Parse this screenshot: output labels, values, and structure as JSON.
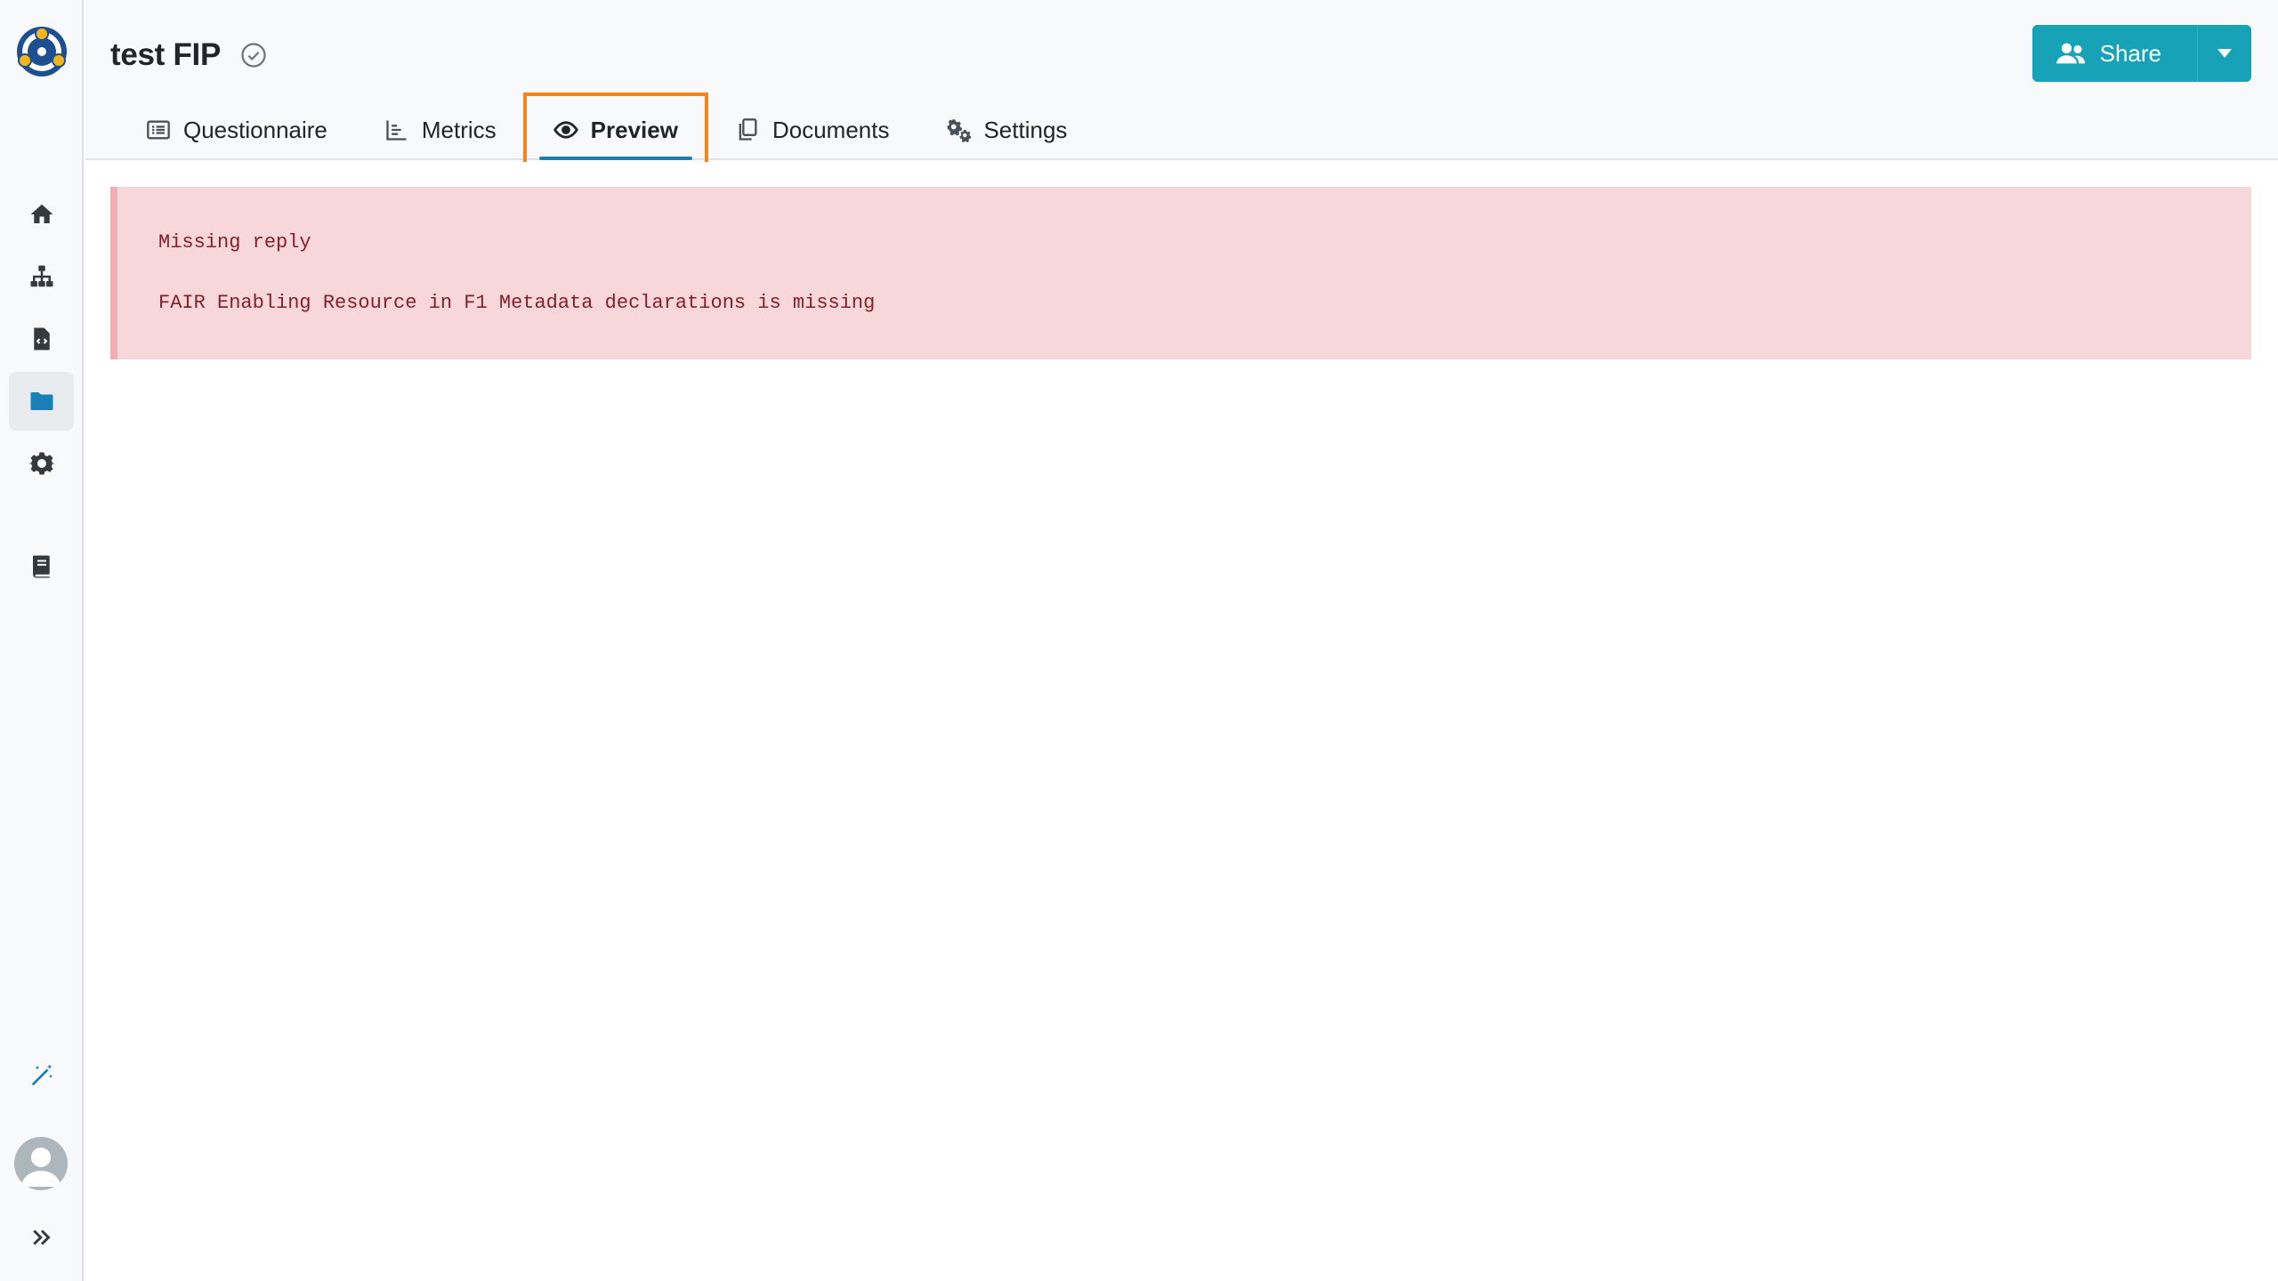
{
  "sidebar": {
    "logo_icon": "fair-connect-logo",
    "items": [
      {
        "icon": "home-icon",
        "active": false
      },
      {
        "icon": "sitemap-icon",
        "active": false
      },
      {
        "icon": "file-code-icon",
        "active": false
      },
      {
        "icon": "folder-icon",
        "active": true
      },
      {
        "icon": "gear-icon",
        "active": false
      },
      {
        "icon": "book-icon",
        "active": false
      },
      {
        "icon": "magic-wand-icon",
        "active": false
      },
      {
        "icon": "expand-chevrons-icon",
        "active": false
      }
    ],
    "avatar": "user-avatar"
  },
  "header": {
    "title": "test FIP",
    "status_icon": "check-circle-icon",
    "share": {
      "label": "Share",
      "icon": "users-icon",
      "caret_icon": "caret-down-icon",
      "color": "#17a2b8"
    },
    "tabs": [
      {
        "label": "Questionnaire",
        "icon": "list-icon",
        "active": false
      },
      {
        "label": "Metrics",
        "icon": "chart-bar-icon",
        "active": false
      },
      {
        "label": "Preview",
        "icon": "eye-icon",
        "active": true
      },
      {
        "label": "Documents",
        "icon": "copy-icon",
        "active": false
      },
      {
        "label": "Settings",
        "icon": "gears-icon",
        "active": false
      }
    ],
    "highlight_color": "#f5841f"
  },
  "preview": {
    "alert_color": "#f8d7da",
    "lines": [
      "Missing reply",
      "FAIR Enabling Resource in F1 Metadata declarations is missing"
    ]
  }
}
